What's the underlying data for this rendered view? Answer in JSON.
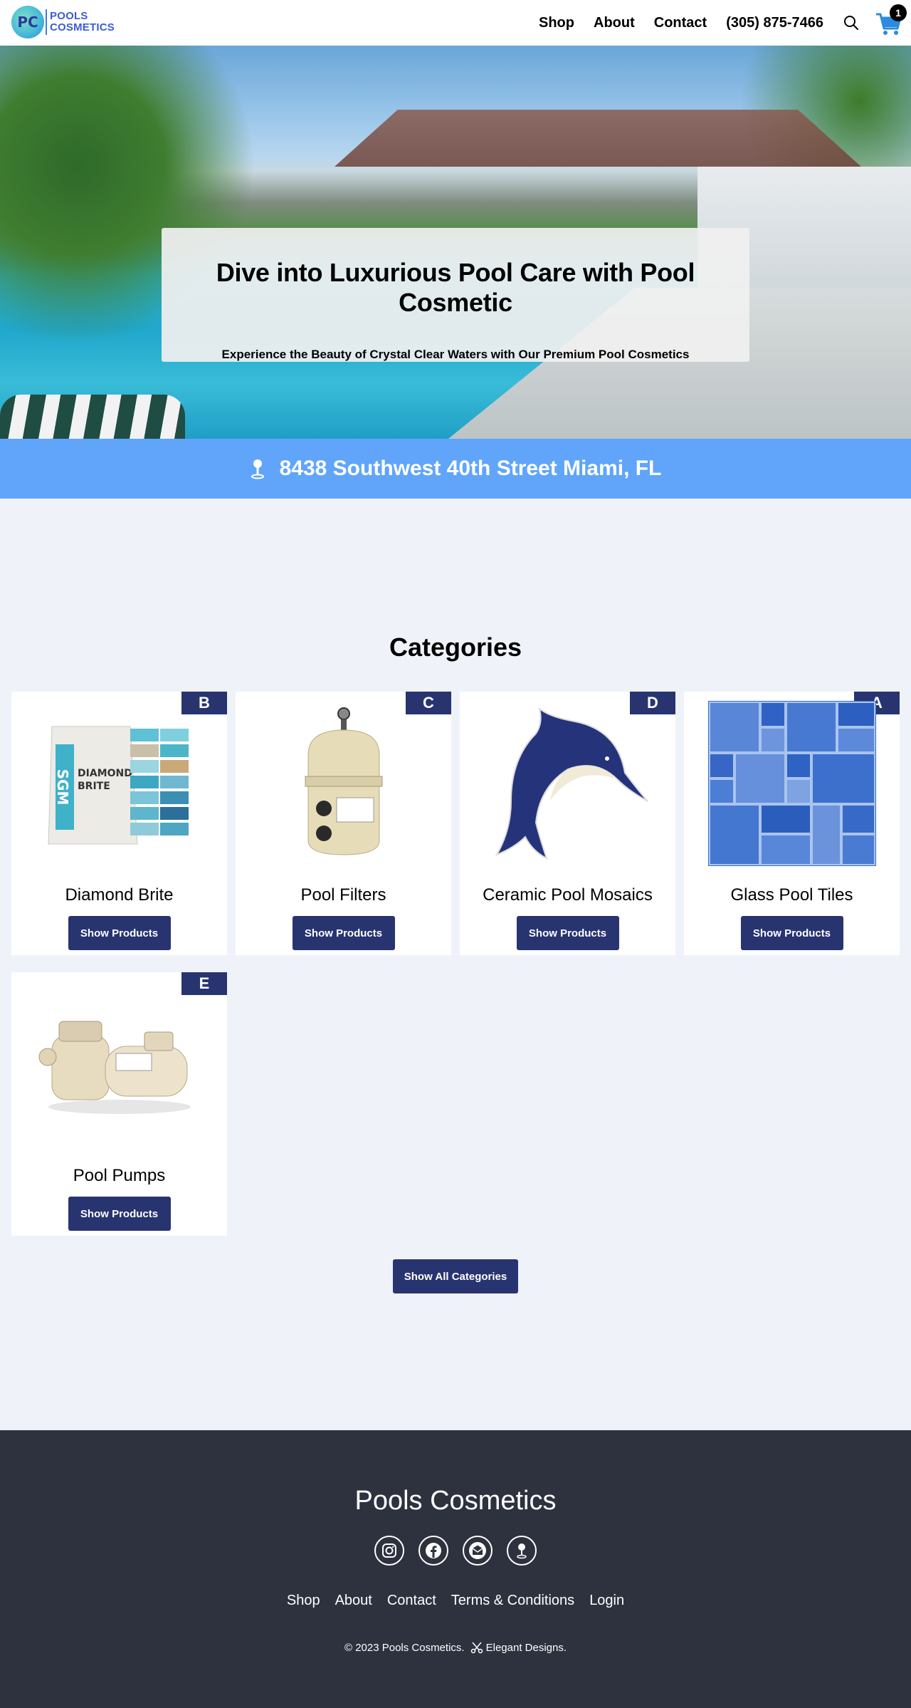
{
  "header": {
    "logo_text_line1": "POOLS",
    "logo_text_line2": "COSMETICS",
    "logo_monogram": "PC",
    "nav": [
      "Shop",
      "About",
      "Contact"
    ],
    "phone": "(305) 875-7466",
    "search_icon": "search-icon",
    "cart_icon": "cart-icon",
    "cart_count": "1"
  },
  "hero": {
    "title": "Dive into Luxurious Pool Care with Pool Cosmetic",
    "subtitle": "Experience the Beauty of Crystal Clear Waters with Our Premium Pool Cosmetics"
  },
  "address": {
    "icon": "map-pin-icon",
    "text": "8438 Southwest 40th Street Miami, FL"
  },
  "categories": {
    "title": "Categories",
    "items": [
      {
        "letter": "B",
        "name": "Diamond Brite",
        "button": "Show Products",
        "image": "diamond-brite-bag"
      },
      {
        "letter": "C",
        "name": "Pool Filters",
        "button": "Show Products",
        "image": "pool-filter"
      },
      {
        "letter": "D",
        "name": "Ceramic Pool Mosaics",
        "button": "Show Products",
        "image": "dolphin-mosaic"
      },
      {
        "letter": "A",
        "name": "Glass Pool Tiles",
        "button": "Show Products",
        "image": "glass-tiles"
      },
      {
        "letter": "E",
        "name": "Pool Pumps",
        "button": "Show Products",
        "image": "pool-pump"
      }
    ],
    "show_all": "Show All Categories"
  },
  "footer": {
    "brand": "Pools Cosmetics",
    "socials": [
      "instagram-icon",
      "facebook-icon",
      "email-icon",
      "location-icon"
    ],
    "links": [
      "Shop",
      "About",
      "Contact",
      "Terms & Conditions",
      "Login"
    ],
    "copyright": "© 2023 Pools Cosmetics.",
    "credit": "Elegant Designs."
  },
  "colors": {
    "primary": "#283470",
    "accent_blue": "#60a5fa",
    "footer_bg": "#2e323f",
    "page_bg": "#eff3f9"
  }
}
